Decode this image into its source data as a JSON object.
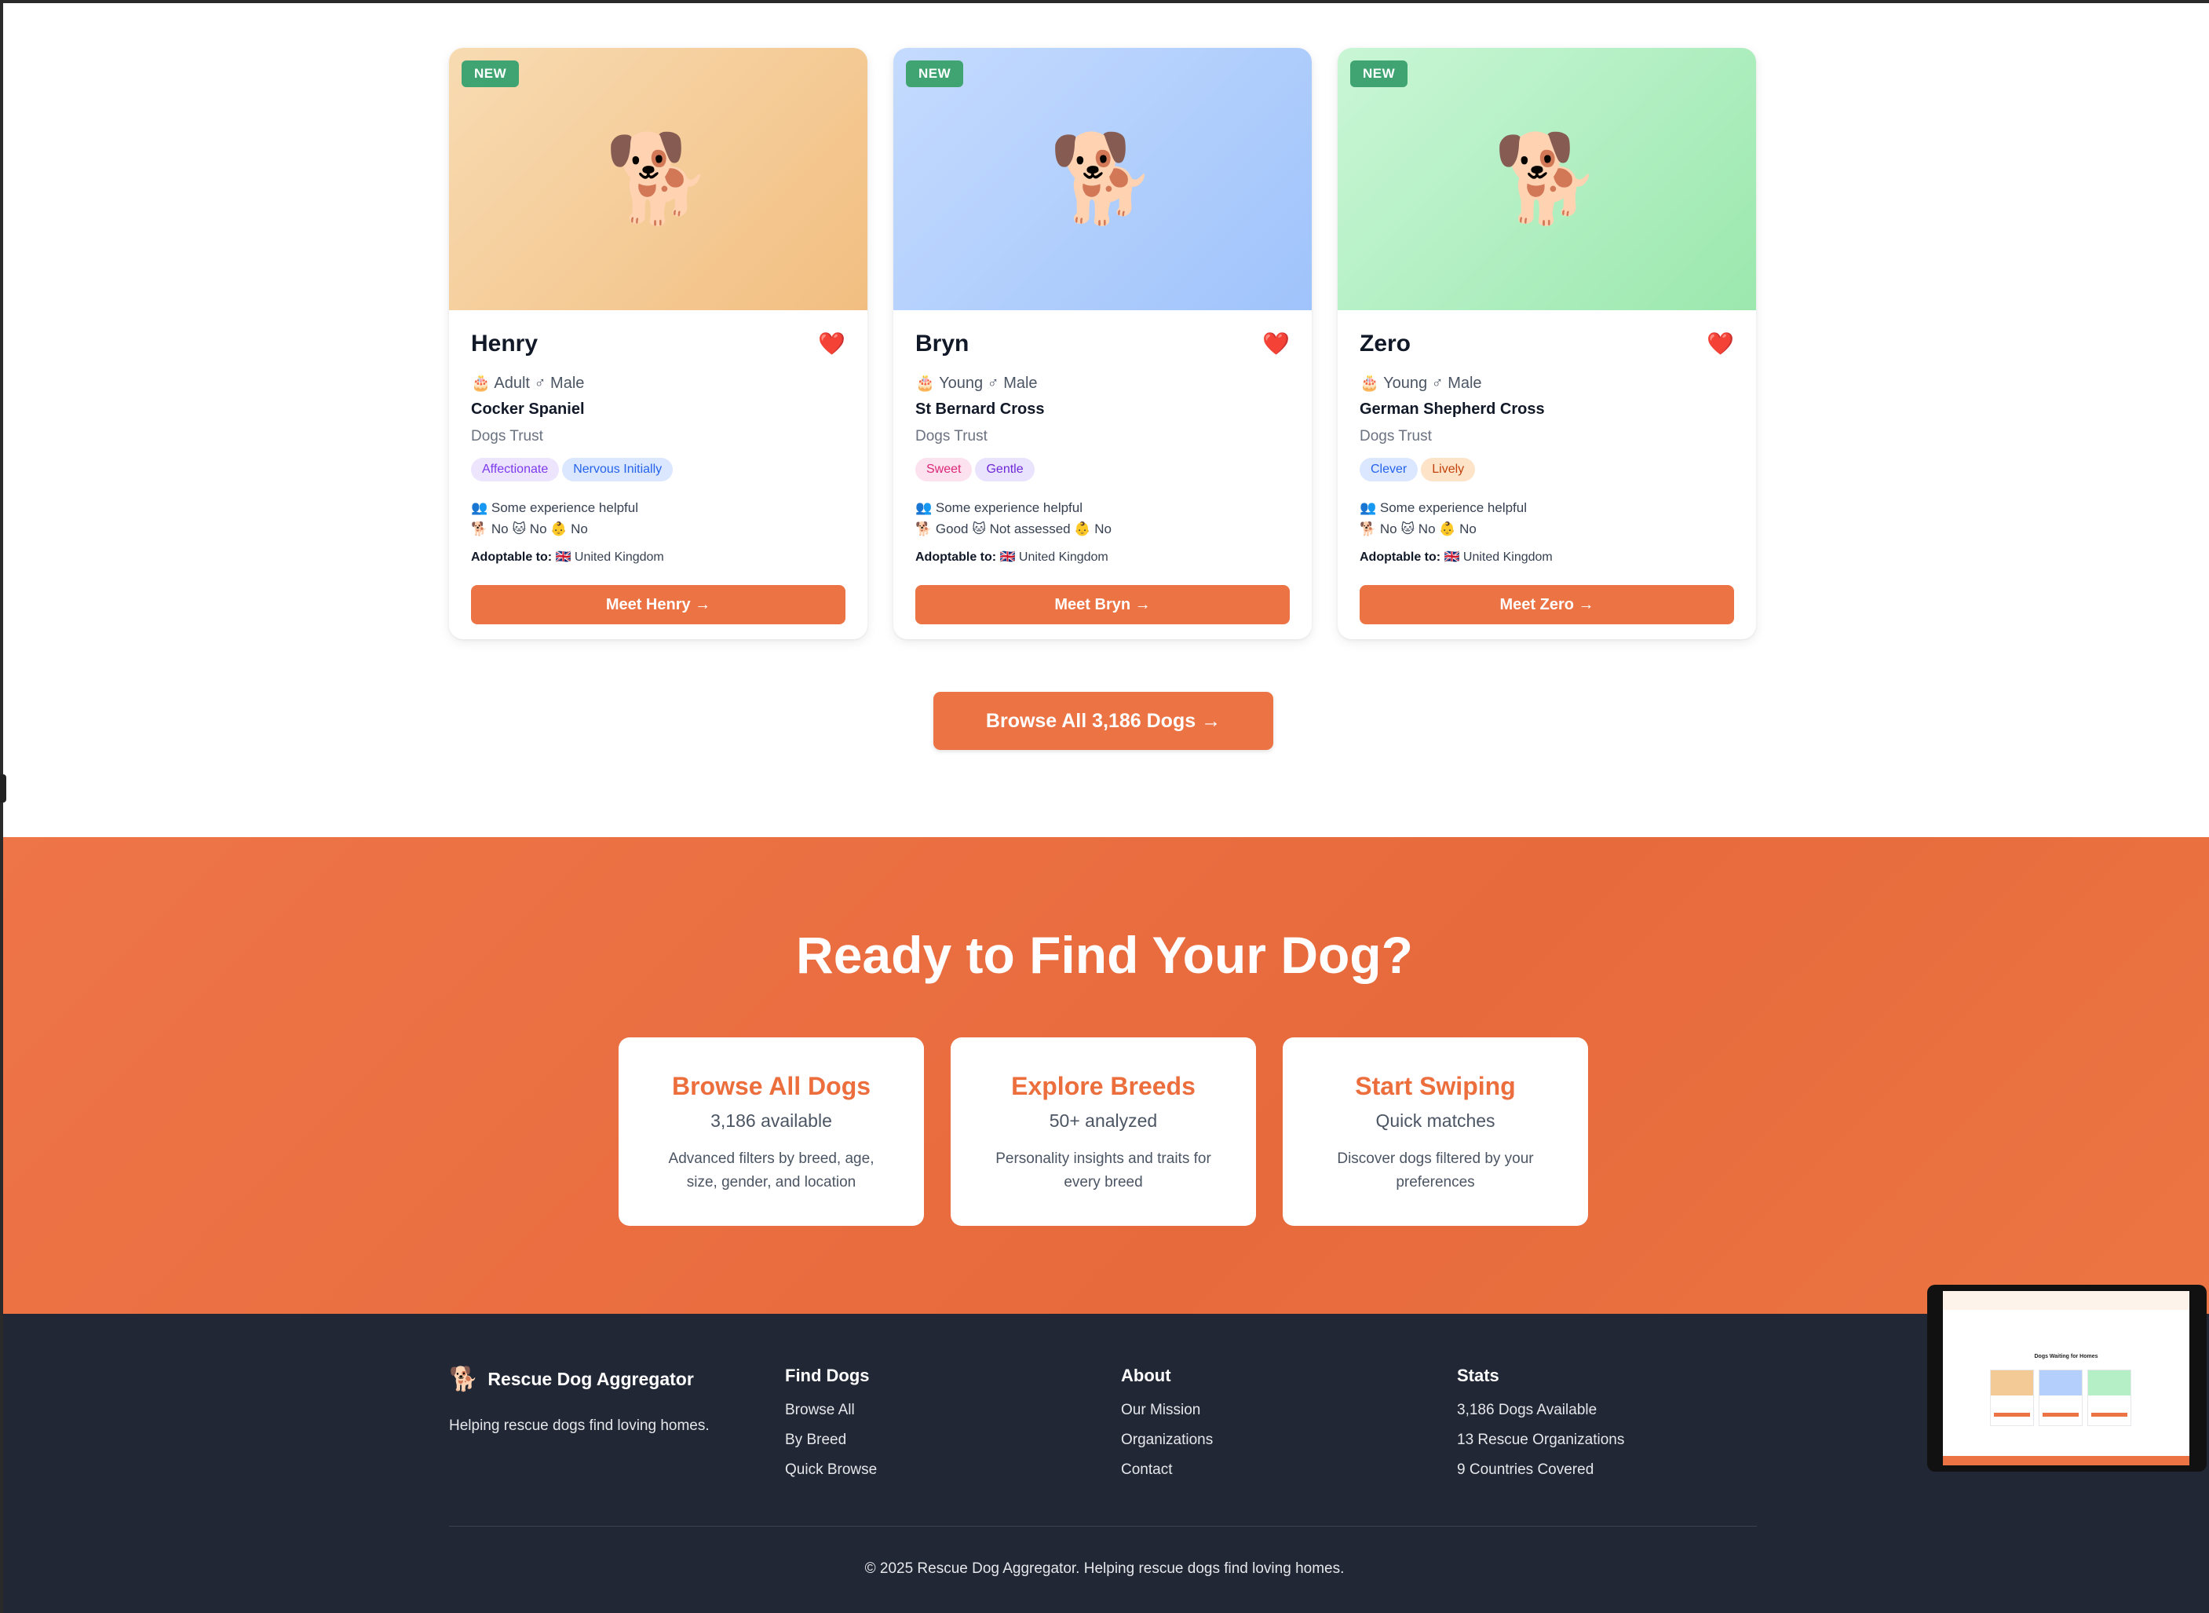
{
  "dogs": [
    {
      "badge": "NEW",
      "name": "Henry",
      "meta": "🎂 Adult ♂ Male",
      "breed": "Cocker Spaniel",
      "org": "Dogs Trust",
      "tags": [
        "Affectionate",
        "Nervous Initially"
      ],
      "experience": "👥 Some experience helpful",
      "compat": "🐕 No 🐱 No 👶 No",
      "adopt_label": "Adoptable to:",
      "adopt_value": "🇬🇧 United Kingdom",
      "button": "Meet Henry →"
    },
    {
      "badge": "NEW",
      "name": "Bryn",
      "meta": "🎂 Young ♂ Male",
      "breed": "St Bernard Cross",
      "org": "Dogs Trust",
      "tags": [
        "Sweet",
        "Gentle"
      ],
      "experience": "👥 Some experience helpful",
      "compat": "🐕 Good 🐱 Not assessed 👶 No",
      "adopt_label": "Adoptable to:",
      "adopt_value": "🇬🇧 United Kingdom",
      "button": "Meet Bryn →"
    },
    {
      "badge": "NEW",
      "name": "Zero",
      "meta": "🎂 Young ♂ Male",
      "breed": "German Shepherd Cross",
      "org": "Dogs Trust",
      "tags": [
        "Clever",
        "Lively"
      ],
      "experience": "👥 Some experience helpful",
      "compat": "🐕 No 🐱 No 👶 No",
      "adopt_label": "Adoptable to:",
      "adopt_value": "🇬🇧 United Kingdom",
      "button": "Meet Zero →"
    }
  ],
  "dog_icon": "🐕",
  "heart_icon": "❤️",
  "browse_all_button": "Browse All 3,186 Dogs →",
  "cta": {
    "title": "Ready to Find Your Dog?",
    "cards": [
      {
        "title": "Browse All Dogs",
        "sub": "3,186 available",
        "desc": "Advanced filters by breed, age, size, gender, and location"
      },
      {
        "title": "Explore Breeds",
        "sub": "50+ analyzed",
        "desc": "Personality insights and traits for every breed"
      },
      {
        "title": "Start Swiping",
        "sub": "Quick matches",
        "desc": "Discover dogs filtered by your preferences"
      }
    ]
  },
  "footer": {
    "brand_icon": "🐕",
    "brand": "Rescue Dog Aggregator",
    "tagline": "Helping rescue dogs find loving homes.",
    "columns": [
      {
        "heading": "Find Dogs",
        "links": [
          "Browse All",
          "By Breed",
          "Quick Browse"
        ]
      },
      {
        "heading": "About",
        "links": [
          "Our Mission",
          "Organizations",
          "Contact"
        ]
      },
      {
        "heading": "Stats",
        "links": [
          "3,186 Dogs Available",
          "13 Rescue Organizations",
          "9 Countries Covered"
        ]
      }
    ],
    "copyright": "© 2025 Rescue Dog Aggregator. Helping rescue dogs find loving homes."
  },
  "mini_preview": {
    "title": "Dogs Waiting for Homes"
  },
  "colors": {
    "accent": "#ec7343",
    "new_badge": "#3fa472",
    "footer_bg": "#212734"
  }
}
